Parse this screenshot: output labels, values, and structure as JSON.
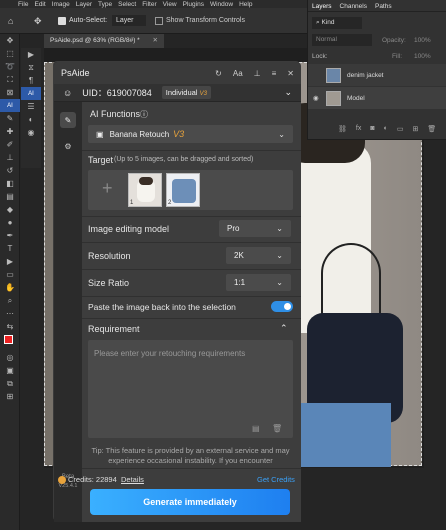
{
  "menu": [
    "File",
    "Edit",
    "Image",
    "Layer",
    "Type",
    "Select",
    "Filter",
    "View",
    "Plugins",
    "Window",
    "Help"
  ],
  "options_bar": {
    "auto_select_label": "Auto-Select:",
    "auto_select_value": "Layer",
    "transform_label": "Show Transform Controls"
  },
  "document_tab": "PsAide.psd @ 63% (RGB/8#) *",
  "layers_panel": {
    "tabs": [
      "Layers",
      "Channels",
      "Paths"
    ],
    "filter": "Kind",
    "blend_mode": "Normal",
    "opacity_label": "Opacity:",
    "opacity_value": "100%",
    "lock_label": "Lock:",
    "fill_label": "Fill:",
    "fill_value": "100%",
    "layers": [
      {
        "name": "denim jacket"
      },
      {
        "name": "Model"
      }
    ]
  },
  "plugin": {
    "title": "PsAide",
    "uid": "UID：619007084",
    "plan": "Individual",
    "plan_badge": "V3",
    "ai_functions_label": "AI Functions",
    "function_value": "Banana Retouch",
    "function_badge": "V3",
    "target_label": "Target",
    "target_hint": "(Up to 5 images, can be dragged and sorted)",
    "thumb_numbers": [
      "1",
      "2"
    ],
    "model_label": "Image editing model",
    "model_value": "Pro",
    "resolution_label": "Resolution",
    "resolution_value": "2K",
    "ratio_label": "Size Ratio",
    "ratio_value": "1:1",
    "paste_back_label": "Paste the image back into the selection",
    "paste_back_on": true,
    "requirement_label": "Requirement",
    "requirement_placeholder": "Please enter your retouching requirements",
    "tip": "Tip: This feature is provided by an external service and may experience occasional instability. If you encounter",
    "credits_label": "Credits: 22894",
    "details_label": "Details",
    "get_credits_label": "Get Credits",
    "version_beta": "Beta",
    "version": "V25.4.1",
    "generate_label": "Generate immediately"
  },
  "colors": {
    "accent": "#2f8fe6",
    "gold_badge": "#e8a33c",
    "panel_bg": "#3d3d3d"
  }
}
